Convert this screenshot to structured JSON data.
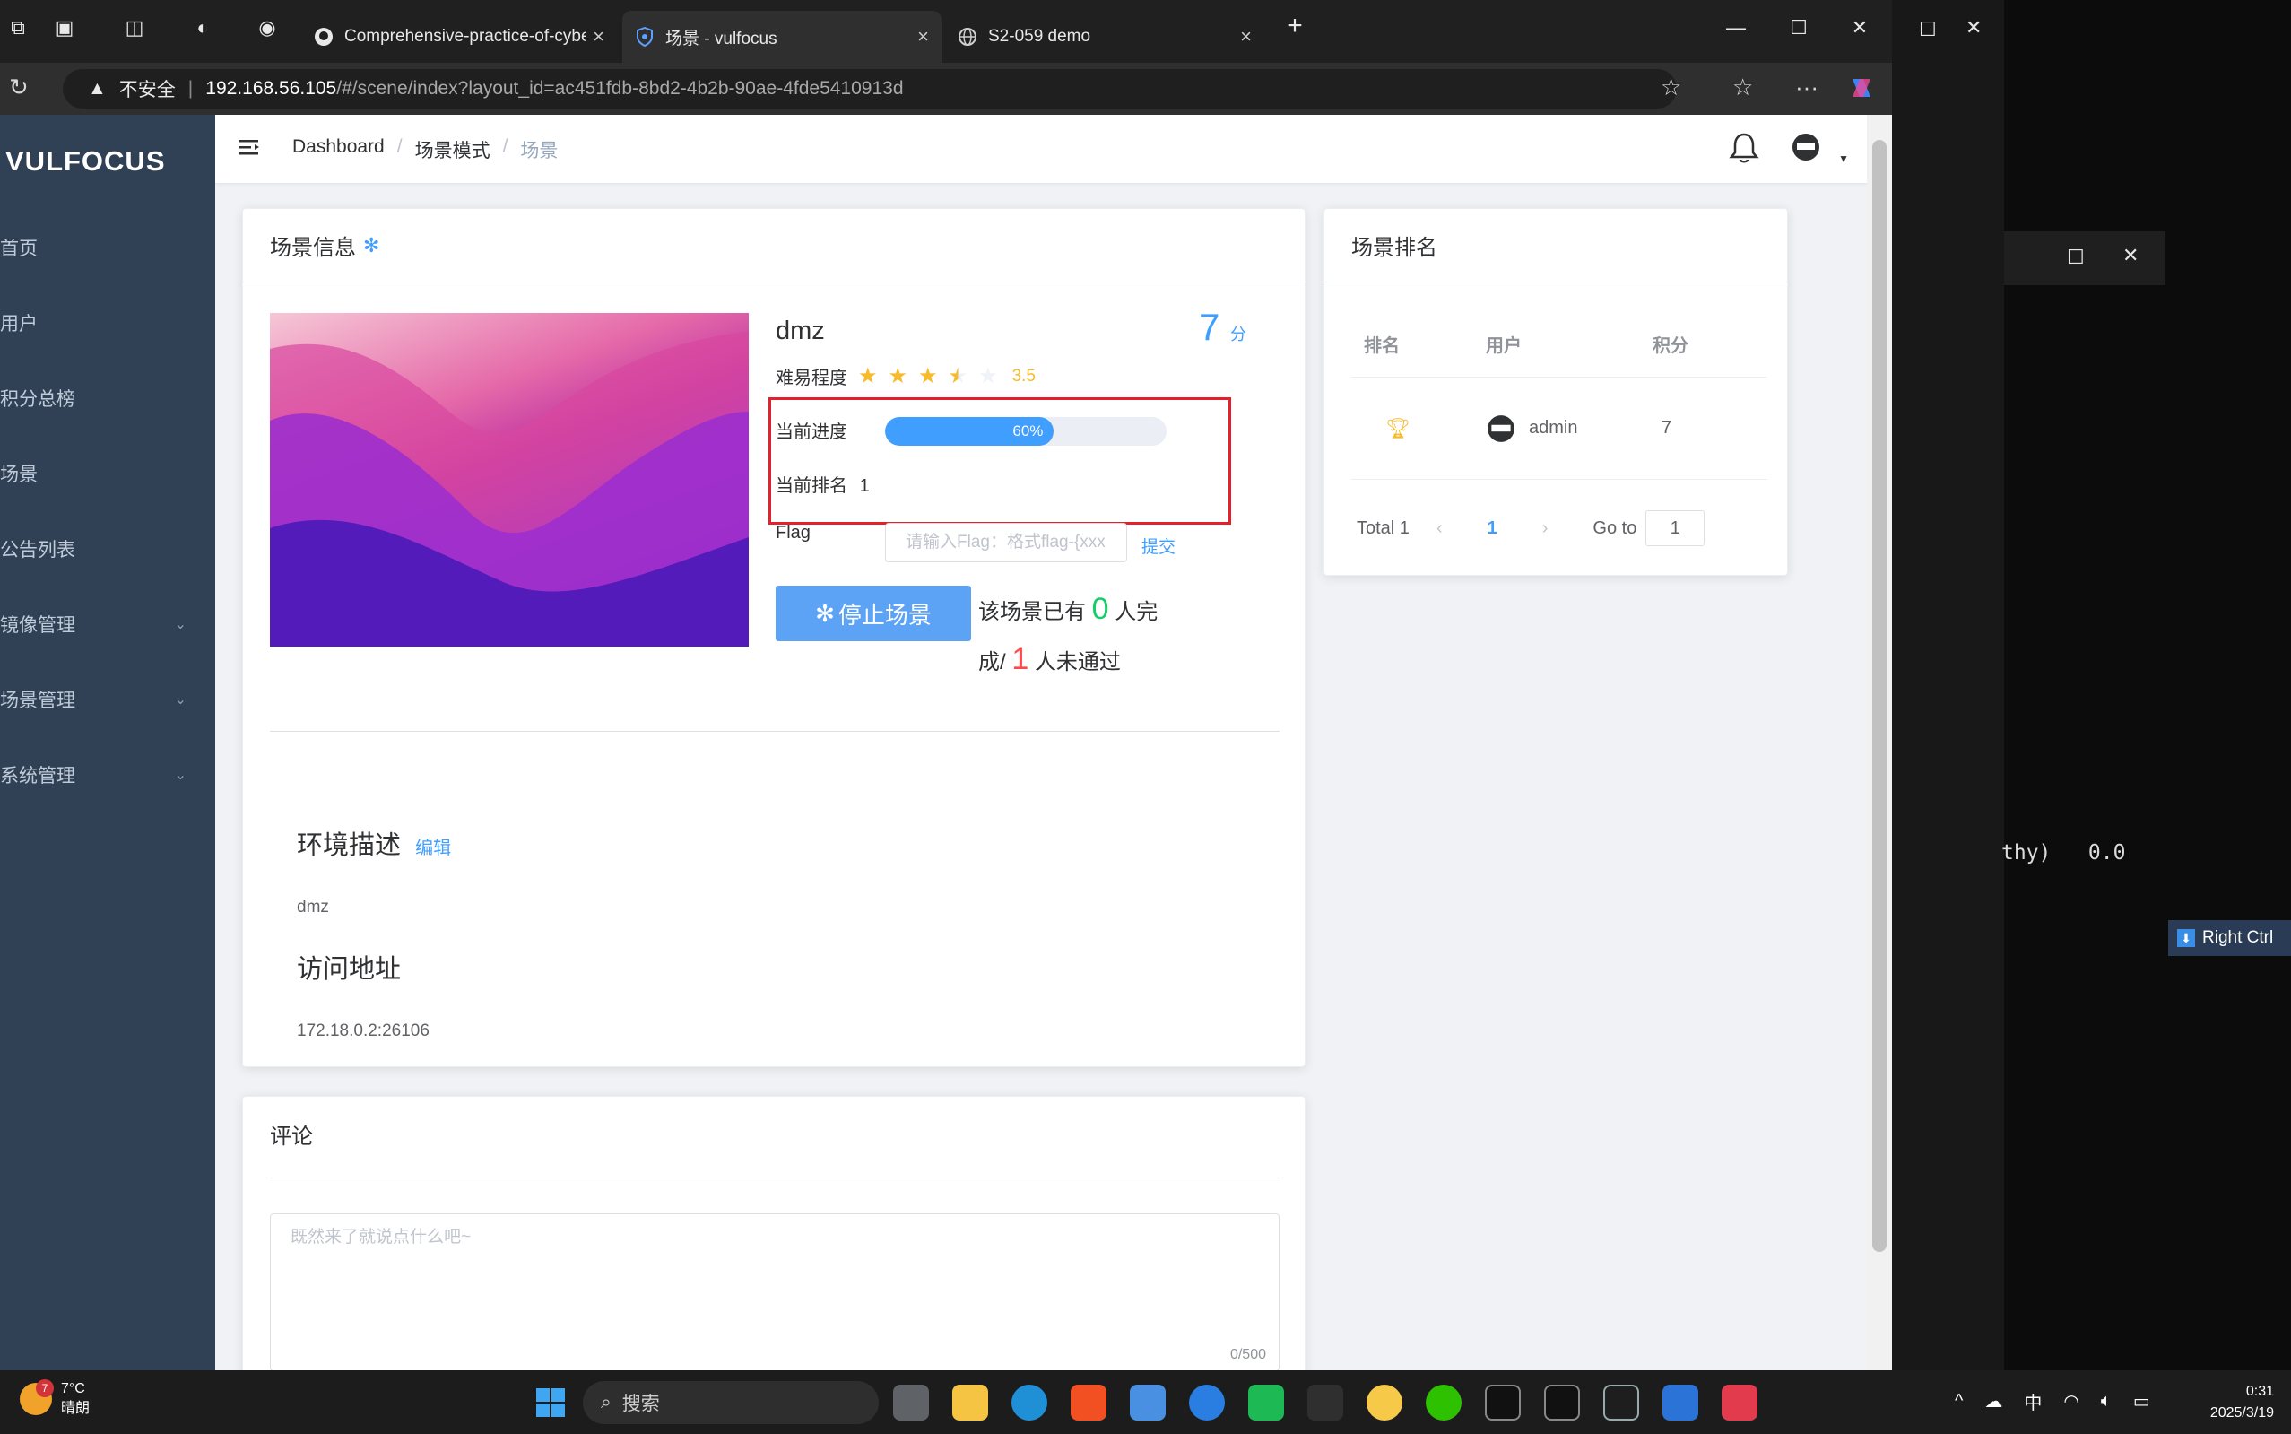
{
  "browser": {
    "tabs": [
      {
        "label": "Comprehensive-practice-of-cyber",
        "icon": "github-icon"
      },
      {
        "label": "场景 - vulfocus",
        "icon": "shield-icon"
      },
      {
        "label": "S2-059 demo",
        "icon": "globe-icon"
      }
    ],
    "url": {
      "security": "不安全",
      "host": "192.168.56.105",
      "path": "/#/scene/index?layout_id=ac451fdb-8bd2-4b2b-90ae-4fde5410913d"
    }
  },
  "app": {
    "logo": "VULFOCUS",
    "menu": [
      {
        "label": "首页"
      },
      {
        "label": "用户"
      },
      {
        "label": "积分总榜"
      },
      {
        "label": "场景"
      },
      {
        "label": "公告列表"
      },
      {
        "label": "镜像管理",
        "has_children": true
      },
      {
        "label": "场景管理",
        "has_children": true
      },
      {
        "label": "系统管理",
        "has_children": true
      }
    ],
    "breadcrumb": [
      "Dashboard",
      "场景模式",
      "场景"
    ]
  },
  "scene_card": {
    "header": "场景信息",
    "name": "dmz",
    "score": "7",
    "score_unit": "分",
    "difficulty_label": "难易程度",
    "difficulty_value": "3.5",
    "difficulty_rating": 3.5,
    "progress_label": "当前进度",
    "progress_text": "60%",
    "progress_fraction": 0.6,
    "rank_label": "当前排名",
    "rank_value": "1",
    "flag_label": "Flag",
    "flag_placeholder": "请输入Flag：格式flag-{xxx",
    "submit_label": "提交",
    "stop_button": "停止场景",
    "stat_prefix": "该场景已有",
    "stat_done": "0",
    "stat_mid_a": "人完",
    "stat_mid_b": "成/",
    "stat_fail": "1",
    "stat_suffix": "人未通过",
    "desc_title": "环境描述",
    "desc_edit": "编辑",
    "desc_text": "dmz",
    "addr_title": "访问地址",
    "addr_text": "172.18.0.2:26106"
  },
  "ranking_card": {
    "header": "场景排名",
    "columns": [
      "排名",
      "用户",
      "积分"
    ],
    "rows": [
      {
        "rank_icon": "trophy-icon",
        "user": "admin",
        "score": "7"
      }
    ],
    "pager": {
      "total": "Total 1",
      "page": "1",
      "goto_label": "Go to",
      "goto_value": "1"
    }
  },
  "comment_card": {
    "header": "评论",
    "placeholder": "既然来了就说点什么吧~",
    "counter": "0/500"
  },
  "terminal": {
    "text": "thy)   0.0",
    "right_ctrl": "Right Ctrl"
  },
  "taskbar": {
    "weather_temp": "7°C",
    "weather_desc": "晴朗",
    "weather_badge": "7",
    "search": "搜索",
    "ime": "中",
    "time": "0:31",
    "date": "2025/3/19"
  }
}
